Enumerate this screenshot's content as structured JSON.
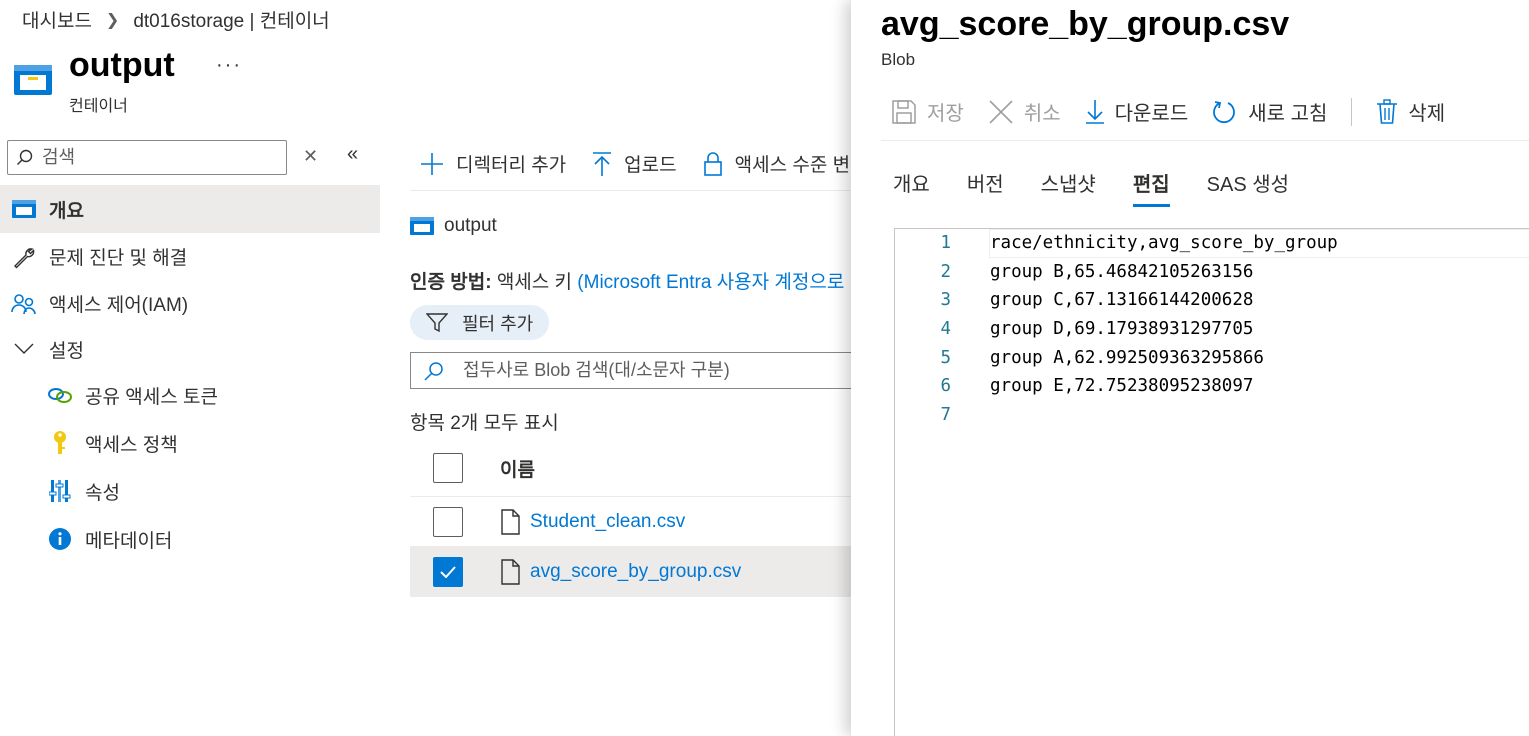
{
  "breadcrumb": {
    "home": "대시보드",
    "current": "dt016storage | 컨테이너"
  },
  "header": {
    "title": "output",
    "subtitle": "컨테이너",
    "more": "···"
  },
  "sidebar": {
    "search_placeholder": "검색",
    "items": [
      {
        "label": "개요",
        "icon": "container-icon"
      },
      {
        "label": "문제 진단 및 해결",
        "icon": "wrench-icon"
      },
      {
        "label": "액세스 제어(IAM)",
        "icon": "people-icon"
      },
      {
        "label": "설정",
        "icon": "chevron-down-icon"
      },
      {
        "label": "공유 액세스 토큰",
        "icon": "link-icon"
      },
      {
        "label": "액세스 정책",
        "icon": "key-icon"
      },
      {
        "label": "속성",
        "icon": "properties-icon"
      },
      {
        "label": "메타데이터",
        "icon": "info-icon"
      }
    ]
  },
  "toolbar": {
    "add_directory": "디렉터리 추가",
    "upload": "업로드",
    "access_level": "액세스 수준 변"
  },
  "content": {
    "container_name": "output",
    "auth_label": "인증 방법:",
    "auth_value": "액세스 키",
    "auth_link": "(Microsoft Entra 사용자 계정으로",
    "filter_label": "필터 추가",
    "blob_search_placeholder": "접두사로 Blob 검색(대/소문자 구분)",
    "items_count": "항목 2개 모두 표시",
    "table": {
      "header": "이름",
      "rows": [
        {
          "name": "Student_clean.csv",
          "selected": false
        },
        {
          "name": "avg_score_by_group.csv",
          "selected": true
        }
      ]
    }
  },
  "panel": {
    "title": "avg_score_by_group.csv",
    "subtitle": "Blob",
    "commands": {
      "save": "저장",
      "cancel": "취소",
      "download": "다운로드",
      "refresh": "새로 고침",
      "delete": "삭제"
    },
    "tabs": [
      "개요",
      "버전",
      "스냅샷",
      "편집",
      "SAS 생성"
    ],
    "active_tab": "편집",
    "editor_lines": [
      {
        "n": "1",
        "text": "race/ethnicity,avg_score_by_group"
      },
      {
        "n": "2",
        "text": "group B,65.4684210526315 6"
      },
      {
        "n": "3",
        "text": "group C,67.13166144200628"
      },
      {
        "n": "4",
        "text": "group D,69.17938931297705"
      },
      {
        "n": "5",
        "text": "group A,62.992509363295866"
      },
      {
        "n": "6",
        "text": "group E,72.75238095238097"
      },
      {
        "n": "7",
        "text": ""
      }
    ]
  },
  "colors": {
    "accent": "#0078d4",
    "selected_bg": "#edebe9",
    "text": "#323130"
  }
}
